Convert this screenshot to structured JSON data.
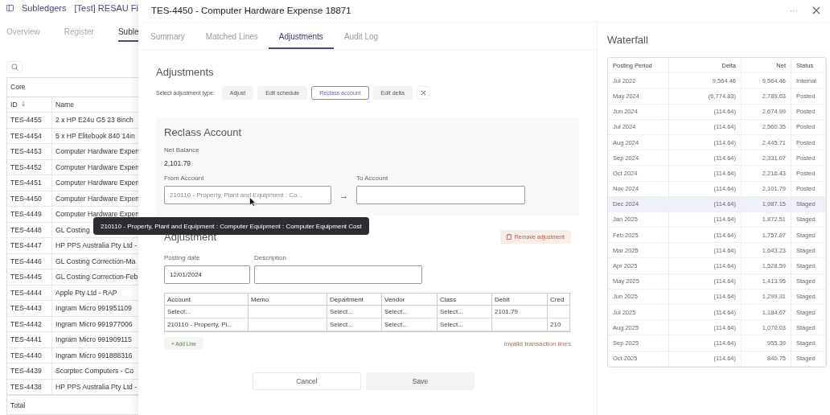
{
  "background": {
    "breadcrumb": [
      "Subledgers",
      "[Test] RESAU Fi"
    ],
    "tabs": [
      {
        "label": "Overview",
        "selected": false
      },
      {
        "label": "Register",
        "selected": false
      },
      {
        "label": "Suble",
        "selected": true
      }
    ],
    "group": "Core",
    "columns": [
      "ID",
      "Name"
    ],
    "rows": [
      {
        "id": "TES-4455",
        "name": "2 x HP E24u G5 23 8inch"
      },
      {
        "id": "TES-4454",
        "name": "5 x HP Elitebook 840 14in"
      },
      {
        "id": "TES-4453",
        "name": "Computer Hardware Expen"
      },
      {
        "id": "TES-4452",
        "name": "Computer Hardware Expen"
      },
      {
        "id": "TES-4451",
        "name": "Computer Hardware Expen"
      },
      {
        "id": "TES-4450",
        "name": "Computer Hardware Expen"
      },
      {
        "id": "TES-4449",
        "name": "Computer Hardware Expen"
      },
      {
        "id": "TES-4448",
        "name": "GL Costing"
      },
      {
        "id": "TES-4447",
        "name": "HP PPS Australia Pty Ltd -"
      },
      {
        "id": "TES-4446",
        "name": "GL Costing Correction-Ma"
      },
      {
        "id": "TES-4445",
        "name": "GL Costing Correction-Feb"
      },
      {
        "id": "TES-4444",
        "name": "Apple Pty Ltd - RAP"
      },
      {
        "id": "TES-4443",
        "name": "Ingram Micro 991951109"
      },
      {
        "id": "TES-4442",
        "name": "Ingram Micro 991977006"
      },
      {
        "id": "TES-4441",
        "name": "Ingram Micro 991909115"
      },
      {
        "id": "TES-4440",
        "name": "Ingram Micro 991888316"
      },
      {
        "id": "TES-4439",
        "name": "Scorptec Computers - Co"
      },
      {
        "id": "TES-4438",
        "name": "HP PPS Australia Pty Ltd -"
      }
    ],
    "total_label": "Total"
  },
  "modal": {
    "title": "TES-4450 - Computer Hardware Expense 18871",
    "more": "···",
    "tabs": [
      {
        "label": "Summary",
        "selected": false
      },
      {
        "label": "Matched Lines",
        "selected": false
      },
      {
        "label": "Adjustments",
        "selected": true
      },
      {
        "label": "Audit Log",
        "selected": false
      }
    ],
    "adjustments": {
      "heading": "Adjustments",
      "type_label": "Select adjustment type:",
      "types": [
        {
          "label": "Adjust",
          "selected": false
        },
        {
          "label": "Edit schedule",
          "selected": false
        },
        {
          "label": "Reclass account",
          "selected": true
        },
        {
          "label": "Edit delta",
          "selected": false
        }
      ]
    },
    "reclass": {
      "heading": "Reclass Account",
      "net_balance_label": "Net Balance",
      "net_balance": "2,101.79",
      "from_label": "From Account",
      "from_value": "210110 - Property, Plant and Equipment : Co...",
      "arrow": "→",
      "to_label": "To Account"
    },
    "tooltip": "210110 - Property, Plant and Equipment : Computer Equipment : Computer Equipment Cost",
    "adjustment": {
      "heading": "Adjustment",
      "remove": "Remove adjustment",
      "date_label": "Posting date",
      "date_value": "12/01/2024",
      "description_label": "Description",
      "columns": [
        "Account",
        "Memo",
        "Department",
        "Vendor",
        "Class",
        "Debit",
        "Cred"
      ],
      "rows": [
        [
          "Select...",
          "",
          "Select...",
          "Select...",
          "Select...",
          "2101.79",
          ""
        ],
        [
          "210110 - Property, Pl...",
          "",
          "Select...",
          "Select...",
          "Select...",
          "",
          "210"
        ]
      ],
      "add_line": "+ Add Line",
      "error": "Invalid transaction lines"
    },
    "cancel": "Cancel",
    "save": "Save",
    "waterfall": {
      "heading": "Waterfall",
      "columns": [
        "Posting Period",
        "Delta",
        "Net",
        "Status"
      ],
      "rows": [
        {
          "period": "Jul 2022",
          "delta": "9,564.46",
          "net": "9,564.46",
          "status": "Internal",
          "selected": false
        },
        {
          "period": "May 2024",
          "delta": "(6,774.83)",
          "net": "2,789.63",
          "status": "Posted",
          "selected": false
        },
        {
          "period": "Jun 2024",
          "delta": "(114.64)",
          "net": "2,674.99",
          "status": "Posted",
          "selected": false
        },
        {
          "period": "Jul 2024",
          "delta": "(114.64)",
          "net": "2,560.35",
          "status": "Posted",
          "selected": false
        },
        {
          "period": "Aug 2024",
          "delta": "(114.64)",
          "net": "2,445.71",
          "status": "Posted",
          "selected": false
        },
        {
          "period": "Sep 2024",
          "delta": "(114.64)",
          "net": "2,331.07",
          "status": "Posted",
          "selected": false
        },
        {
          "period": "Oct 2024",
          "delta": "(114.64)",
          "net": "2,216.43",
          "status": "Posted",
          "selected": false
        },
        {
          "period": "Nov 2024",
          "delta": "(114.64)",
          "net": "2,101.79",
          "status": "Posted",
          "selected": false
        },
        {
          "period": "Dec 2024",
          "delta": "(114.64)",
          "net": "1,987.15",
          "status": "Staged",
          "selected": true
        },
        {
          "period": "Jan 2025",
          "delta": "(114.64)",
          "net": "1,872.51",
          "status": "Staged",
          "selected": false
        },
        {
          "period": "Feb 2025",
          "delta": "(114.64)",
          "net": "1,757.87",
          "status": "Staged",
          "selected": false
        },
        {
          "period": "Mar 2025",
          "delta": "(114.64)",
          "net": "1,643.23",
          "status": "Staged",
          "selected": false
        },
        {
          "period": "Apr 2025",
          "delta": "(114.64)",
          "net": "1,528.59",
          "status": "Staged",
          "selected": false
        },
        {
          "period": "May 2025",
          "delta": "(114.64)",
          "net": "1,413.95",
          "status": "Staged",
          "selected": false
        },
        {
          "period": "Jun 2025",
          "delta": "(114.64)",
          "net": "1,299.31",
          "status": "Staged",
          "selected": false
        },
        {
          "period": "Jul 2025",
          "delta": "(114.64)",
          "net": "1,184.67",
          "status": "Staged",
          "selected": false
        },
        {
          "period": "Aug 2025",
          "delta": "(114.64)",
          "net": "1,070.03",
          "status": "Staged",
          "selected": false
        },
        {
          "period": "Sep 2025",
          "delta": "(114.64)",
          "net": "955.39",
          "status": "Staged",
          "selected": false
        },
        {
          "period": "Oct 2025",
          "delta": "(114.64)",
          "net": "840.75",
          "status": "Staged",
          "selected": false
        }
      ]
    }
  }
}
